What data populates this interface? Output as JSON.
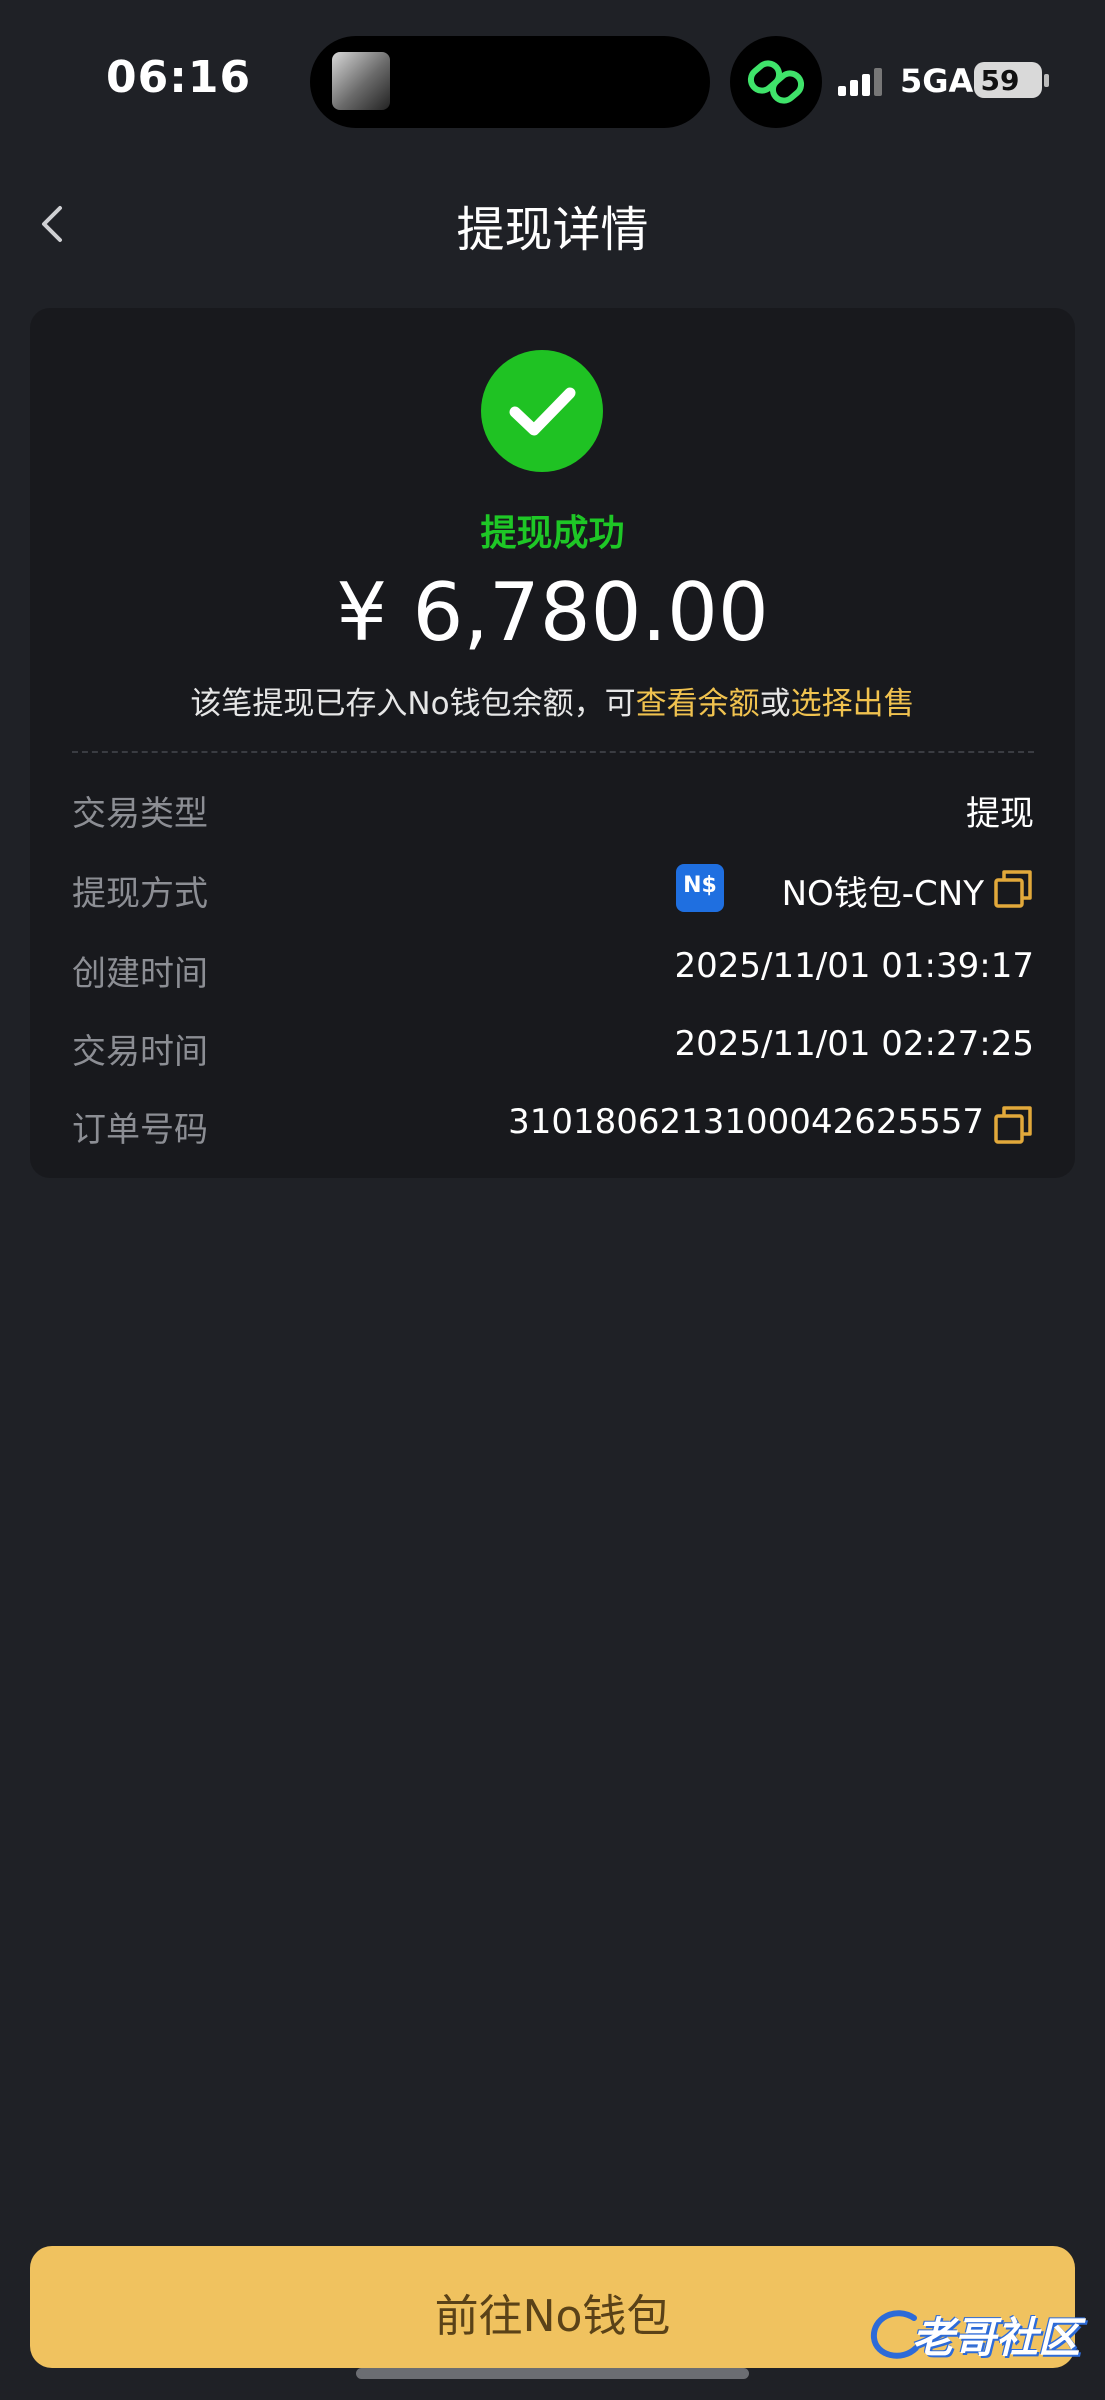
{
  "status_bar": {
    "time": "06:16",
    "network": "5GA",
    "battery": "59"
  },
  "header": {
    "title": "提现详情",
    "back_icon": "chevron-left-icon"
  },
  "result": {
    "status": "提现成功",
    "status_color": "#1ec726",
    "amount": "¥ 6,780.00",
    "note_prefix": "该笔提现已存入No钱包余额，可",
    "note_link_balance": "查看余额",
    "note_conjunction": "或",
    "note_link_sell": "选择出售",
    "link_color": "#f0c24f"
  },
  "details": [
    {
      "label": "交易类型",
      "value": "提现"
    },
    {
      "label": "提现方式",
      "value": "NO钱包-CNY",
      "badge": "N$"
    },
    {
      "label": "创建时间",
      "value": "2025/11/01 01:39:17"
    },
    {
      "label": "交易时间",
      "value": "2025/11/01 02:27:25"
    },
    {
      "label": "订单号码",
      "value": "3101806213100042625557"
    }
  ],
  "cta": {
    "label": "前往No钱包",
    "color": "#f0c25f"
  },
  "watermark": {
    "text": "老哥社区"
  }
}
